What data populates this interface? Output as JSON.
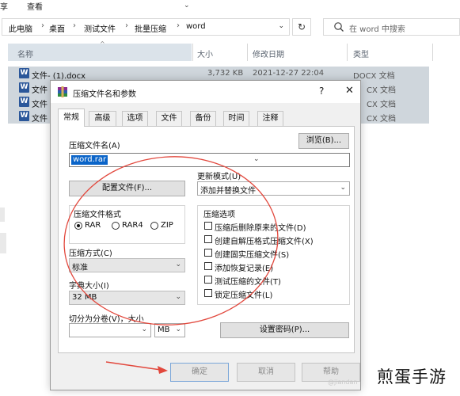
{
  "menubar": {
    "items": [
      "享",
      "查看"
    ]
  },
  "address": {
    "crumbs": [
      "此电脑",
      "桌面",
      "测试文件",
      "批量压缩",
      "word"
    ],
    "separator": "›",
    "search_placeholder": "在 word 中搜索"
  },
  "columns": {
    "name": "名称",
    "size": "大小",
    "date": "修改日期",
    "type": "类型"
  },
  "files": [
    {
      "name": "文件- (1).docx",
      "size": "3,732 KB",
      "date": "2021-12-27 22:04",
      "type": "DOCX 文档"
    },
    {
      "name": "文件",
      "size": "",
      "date": "",
      "type": "CX 文档"
    },
    {
      "name": "文件",
      "size": "",
      "date": "",
      "type": "CX 文档"
    },
    {
      "name": "文件",
      "size": "",
      "date": "",
      "type": "CX 文档"
    }
  ],
  "dialog": {
    "title": "压缩文件名和参数",
    "help": "?",
    "close": "✕",
    "tabs": [
      "常规",
      "高级",
      "选项",
      "文件",
      "备份",
      "时间",
      "注释"
    ],
    "archive_name_label": "压缩文件名(A)",
    "browse_label": "浏览(B)...",
    "archive_name_value": "word.rar",
    "profiles_label": "配置文件(F)...",
    "update_mode_label": "更新模式(U)",
    "update_mode_value": "添加并替换文件",
    "format_label": "压缩文件格式",
    "formats": [
      {
        "label": "RAR",
        "checked": true
      },
      {
        "label": "RAR4",
        "checked": false
      },
      {
        "label": "ZIP",
        "checked": false
      }
    ],
    "method_label": "压缩方式(C)",
    "method_value": "标准",
    "dict_label": "字典大小(I)",
    "dict_value": "32 MB",
    "split_label": "切分为分卷(V)，大小",
    "split_unit": "MB",
    "options_label": "压缩选项",
    "options": [
      {
        "label": "压缩后删除原来的文件(D)",
        "checked": false
      },
      {
        "label": "创建自解压格式压缩文件(X)",
        "checked": false
      },
      {
        "label": "创建固实压缩文件(S)",
        "checked": false
      },
      {
        "label": "添加恢复记录(E)",
        "checked": false
      },
      {
        "label": "测试压缩的文件(T)",
        "checked": false
      },
      {
        "label": "锁定压缩文件(L)",
        "checked": false
      }
    ],
    "password_label": "设置密码(P)...",
    "ok_label": "确定",
    "cancel_label": "取消",
    "help_label": "帮助"
  },
  "watermark": {
    "text": "煎蛋手游",
    "sub": "@jiandan"
  },
  "colors": {
    "annotation_red": "#e2483d",
    "selection_blue": "#0a64c8",
    "word_blue": "#2b579a"
  }
}
